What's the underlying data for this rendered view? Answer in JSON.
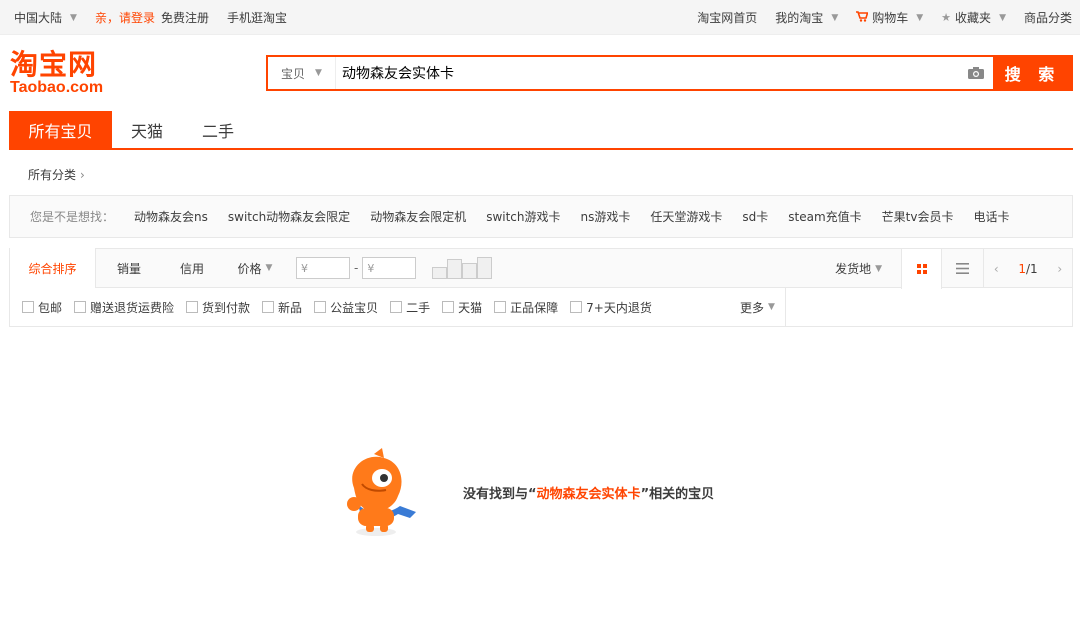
{
  "topbar": {
    "region": "中国大陆",
    "login": "亲，请登录",
    "register": "免费注册",
    "mobile": "手机逛淘宝",
    "home": "淘宝网首页",
    "my_taobao": "我的淘宝",
    "cart": "购物车",
    "favorites": "收藏夹",
    "categories": "商品分类"
  },
  "logo": {
    "cn": "淘宝网",
    "en": "Taobao.com"
  },
  "search": {
    "scope": "宝贝",
    "query": "动物森友会实体卡",
    "button": "搜 索"
  },
  "tabs": [
    {
      "label": "所有宝贝",
      "active": true
    },
    {
      "label": "天猫"
    },
    {
      "label": "二手"
    }
  ],
  "category": {
    "label": "所有分类"
  },
  "suggestions": {
    "label": "您是不是想找：",
    "items": [
      "动物森友会ns",
      "switch动物森友会限定",
      "动物森友会限定机",
      "switch游戏卡",
      "ns游戏卡",
      "任天堂游戏卡",
      "sd卡",
      "steam充值卡",
      "芒果tv会员卡",
      "电话卡"
    ]
  },
  "sort": {
    "items": [
      "综合排序",
      "销量",
      "信用",
      "价格"
    ],
    "price_from": "¥",
    "price_to": "¥",
    "ship_from": "发货地",
    "page_current": "1",
    "page_sep": "/",
    "page_total": "1"
  },
  "filters": {
    "items": [
      "包邮",
      "赠送退货运费险",
      "货到付款",
      "新品",
      "公益宝贝",
      "二手",
      "天猫",
      "正品保障",
      "7+天内退货"
    ],
    "more": "更多"
  },
  "empty": {
    "prefix": "没有找到与“",
    "keyword": "动物森友会实体卡",
    "suffix": "”相关的宝贝"
  },
  "colors": {
    "accent": "#ff4400"
  }
}
